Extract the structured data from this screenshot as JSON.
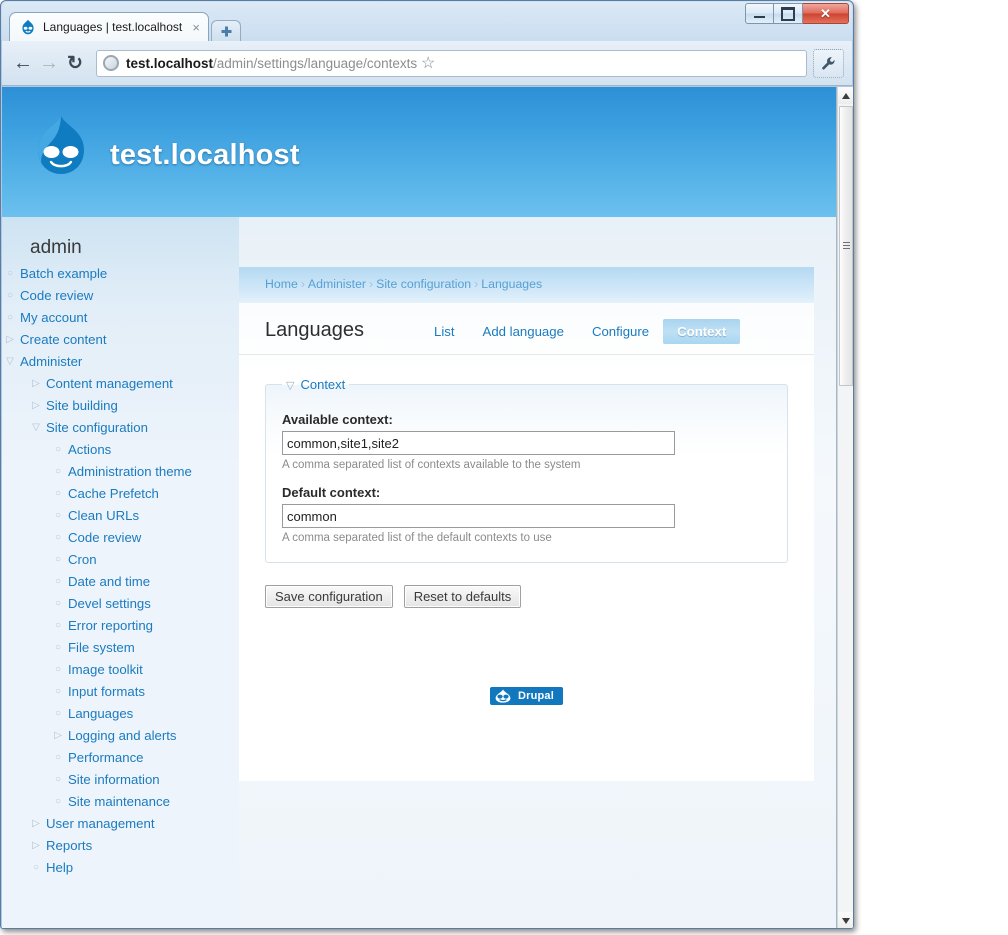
{
  "browser": {
    "tab_title": "Languages | test.localhost",
    "tab_close_glyph": "×",
    "new_tab_glyph": "➕",
    "back_glyph": "←",
    "forward_glyph": "→",
    "reload_glyph": "↻",
    "star_glyph": "☆",
    "url_host": "test.localhost",
    "url_path": "/admin/settings/language/contexts",
    "window_close_glyph": "✕"
  },
  "site": {
    "name": "test.localhost"
  },
  "sidebar": {
    "title": "admin",
    "items": [
      {
        "label": "Batch example",
        "level": 0,
        "marker": "circle"
      },
      {
        "label": "Code review",
        "level": 0,
        "marker": "circle"
      },
      {
        "label": "My account",
        "level": 0,
        "marker": "circle"
      },
      {
        "label": "Create content",
        "level": 0,
        "marker": "collapsed"
      },
      {
        "label": "Administer",
        "level": 0,
        "marker": "expanded"
      },
      {
        "label": "Content management",
        "level": 1,
        "marker": "collapsed"
      },
      {
        "label": "Site building",
        "level": 1,
        "marker": "collapsed"
      },
      {
        "label": "Site configuration",
        "level": 1,
        "marker": "expanded"
      },
      {
        "label": "Actions",
        "level": 2,
        "marker": "circle"
      },
      {
        "label": "Administration theme",
        "level": 2,
        "marker": "circle"
      },
      {
        "label": "Cache Prefetch",
        "level": 2,
        "marker": "circle"
      },
      {
        "label": "Clean URLs",
        "level": 2,
        "marker": "circle"
      },
      {
        "label": "Code review",
        "level": 2,
        "marker": "circle"
      },
      {
        "label": "Cron",
        "level": 2,
        "marker": "circle"
      },
      {
        "label": "Date and time",
        "level": 2,
        "marker": "circle"
      },
      {
        "label": "Devel settings",
        "level": 2,
        "marker": "circle"
      },
      {
        "label": "Error reporting",
        "level": 2,
        "marker": "circle"
      },
      {
        "label": "File system",
        "level": 2,
        "marker": "circle"
      },
      {
        "label": "Image toolkit",
        "level": 2,
        "marker": "circle"
      },
      {
        "label": "Input formats",
        "level": 2,
        "marker": "circle"
      },
      {
        "label": "Languages",
        "level": 2,
        "marker": "circle"
      },
      {
        "label": "Logging and alerts",
        "level": 2,
        "marker": "collapsed"
      },
      {
        "label": "Performance",
        "level": 2,
        "marker": "circle"
      },
      {
        "label": "Site information",
        "level": 2,
        "marker": "circle"
      },
      {
        "label": "Site maintenance",
        "level": 2,
        "marker": "circle"
      },
      {
        "label": "User management",
        "level": 1,
        "marker": "collapsed"
      },
      {
        "label": "Reports",
        "level": 1,
        "marker": "collapsed"
      },
      {
        "label": "Help",
        "level": 1,
        "marker": "circle"
      }
    ],
    "markers": {
      "circle": "○",
      "collapsed": "▷",
      "expanded": "▽"
    }
  },
  "breadcrumb": {
    "separator": "›",
    "items": [
      "Home",
      "Administer",
      "Site configuration",
      "Languages"
    ]
  },
  "main": {
    "page_title": "Languages",
    "tabs": [
      {
        "label": "List",
        "active": false
      },
      {
        "label": "Add language",
        "active": false
      },
      {
        "label": "Configure",
        "active": false
      },
      {
        "label": "Context",
        "active": true
      }
    ]
  },
  "form": {
    "fieldset_legend": "Context",
    "fieldset_toggle_glyph": "▽",
    "fields": [
      {
        "label": "Available context:",
        "value": "common,site1,site2",
        "description": "A comma separated list of contexts available to the system"
      },
      {
        "label": "Default context:",
        "value": "common",
        "description": "A comma separated list of the default contexts to use"
      }
    ],
    "buttons": [
      {
        "label": "Save configuration"
      },
      {
        "label": "Reset to defaults"
      }
    ]
  },
  "footer": {
    "badge_text": "Drupal"
  },
  "colors": {
    "header_blue": "#3b9fdf",
    "link_blue": "#1b7bbf",
    "active_tab_blue": "#a8d4ef",
    "drupal_badge_blue": "#1278be"
  }
}
